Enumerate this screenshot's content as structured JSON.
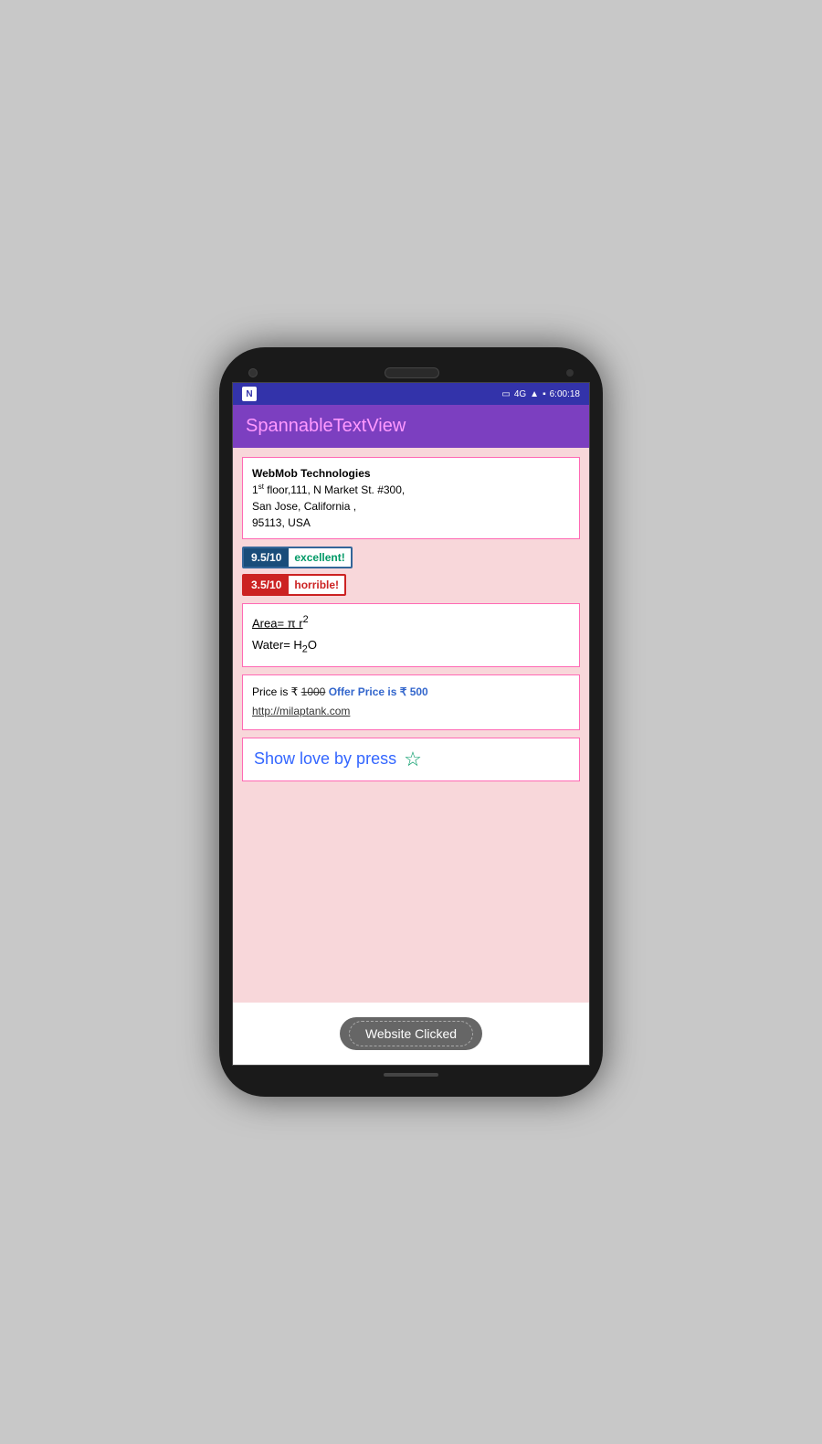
{
  "statusBar": {
    "logo": "N",
    "signal": "4G",
    "time": "6:00:18"
  },
  "appBar": {
    "title": "SpannableTextView"
  },
  "addressCard": {
    "companyName": "WebMob Technologies",
    "line1_pre": "1",
    "line1_sup": "st",
    "line1_post": " floor,111, N Market St. #300,",
    "line2": "San Jose, California ,",
    "line3": "95113, USA"
  },
  "ratingExcellent": {
    "score": "9.5/10",
    "label": "excellent!"
  },
  "ratingHorrible": {
    "score": "3.5/10",
    "label": "horrible!"
  },
  "formulaCard": {
    "areaFormula_pre": "Area= π r",
    "areaFormula_sup": "2",
    "waterFormula_pre": "Water= H",
    "waterFormula_sub": "2",
    "waterFormula_post": "O"
  },
  "priceCard": {
    "priceLabel": "Price is ₹",
    "originalPrice": "1000",
    "offerLabel": "Offer Price is ₹ 500",
    "link": "http://milaptank.com"
  },
  "loveCard": {
    "text": "Show love by press",
    "starIcon": "☆"
  },
  "bottomButton": {
    "label": "Website Clicked"
  }
}
